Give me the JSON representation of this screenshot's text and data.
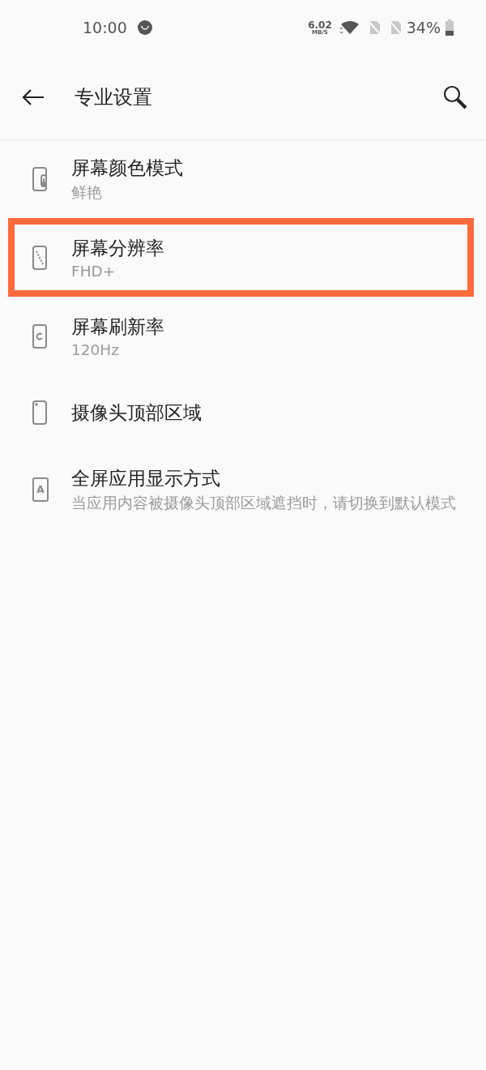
{
  "status_bar": {
    "time": "10:00",
    "net_speed": "6.02",
    "net_unit": "MB/S",
    "battery": "34%"
  },
  "header": {
    "title": "专业设置"
  },
  "items": [
    {
      "kind": "thermometer",
      "title": "屏幕颜色模式",
      "subtitle": "鲜艳",
      "highlighted": false
    },
    {
      "kind": "diagonal",
      "title": "屏幕分辨率",
      "subtitle": "FHD+",
      "highlighted": true
    },
    {
      "kind": "refresh",
      "title": "屏幕刷新率",
      "subtitle": "120Hz",
      "highlighted": false
    },
    {
      "kind": "camera",
      "title": "摄像头顶部区域",
      "highlighted": false
    },
    {
      "kind": "letter",
      "icon_letter": "A",
      "title": "全屏应用显示方式",
      "subtitle": "当应用内容被摄像头顶部区域遮挡时，请切换到默认模式",
      "highlighted": false
    }
  ]
}
